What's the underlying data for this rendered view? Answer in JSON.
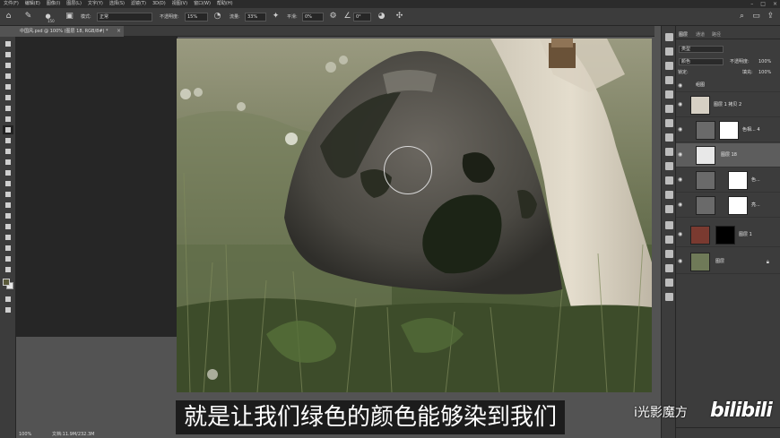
{
  "menubar": {
    "items": [
      "文件(F)",
      "编辑(E)",
      "图像(I)",
      "图层(L)",
      "文字(Y)",
      "选择(S)",
      "滤镜(T)",
      "3D(D)",
      "视图(V)",
      "窗口(W)",
      "帮助(H)"
    ],
    "window_controls": [
      "–",
      "□",
      "×"
    ]
  },
  "options": {
    "brush_size": "150",
    "mode_label": "模式:",
    "mode_value": "正常",
    "opacity_label": "不透明度:",
    "opacity_value": "15%",
    "flow_label": "流量:",
    "flow_value": "33%",
    "smoothing_label": "平滑:",
    "smoothing_value": "0%",
    "angle_value": "0°"
  },
  "document": {
    "tab_title": "中国风.psd @ 100% (图层 18, RGB/8#) *",
    "close_glyph": "×"
  },
  "status": {
    "zoom": "100%",
    "doc_size": "文档:11.9M/232.3M"
  },
  "layers_panel": {
    "tabs": [
      "图层",
      "通道",
      "路径"
    ],
    "filter_label": "类型",
    "blend_mode": "颜色",
    "opacity_label": "不透明度:",
    "opacity_value": "100%",
    "lock_label": "锁定:",
    "fill_label": "填充:",
    "fill_value": "100%",
    "group_name": "组图",
    "layers": [
      {
        "name": "图层 1 拷贝 2"
      },
      {
        "name": "色相... 4"
      },
      {
        "name": "图层 18"
      },
      {
        "name": "色..."
      },
      {
        "name": "亮..."
      },
      {
        "name": "图层 1"
      },
      {
        "name": "图层"
      }
    ]
  },
  "overlay": {
    "subtitle": "就是让我们绿色的颜色能够染到我们",
    "watermark_text": "i光影魔方",
    "watermark_logo": "bilibili"
  },
  "colors": {
    "foreground": "#5a5a3a",
    "background": "#e8e8e8",
    "selected_layer": "#5d5d5d"
  }
}
